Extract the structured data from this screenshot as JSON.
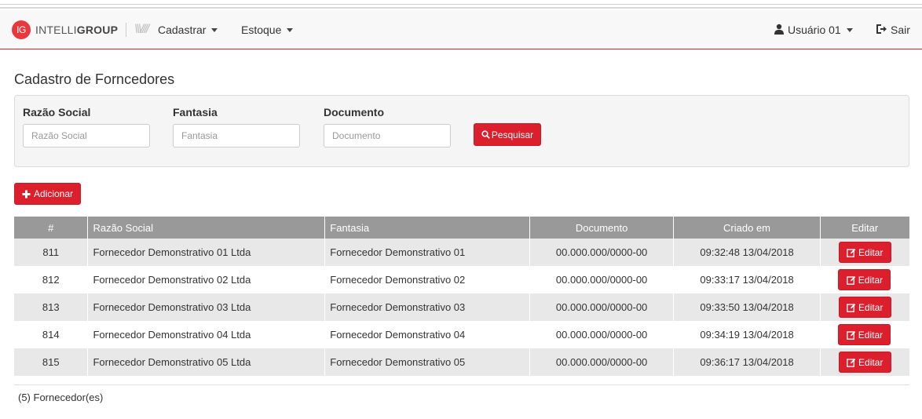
{
  "navbar": {
    "brand_badge": "IG",
    "brand_light": "INTELLI",
    "brand_bold": "GROUP",
    "brand_mark": "\\\\\\////",
    "menu": [
      {
        "label": "Cadastrar"
      },
      {
        "label": "Estoque"
      }
    ],
    "user_label": "Usuário 01",
    "logout_label": "Sair"
  },
  "page": {
    "title": "Cadastro de Forncedores"
  },
  "filters": {
    "razao_label": "Razão Social",
    "razao_placeholder": "Razão Social",
    "fantasia_label": "Fantasia",
    "fantasia_placeholder": "Fantasia",
    "documento_label": "Documento",
    "documento_placeholder": "Documento",
    "search_label": "Pesquisar"
  },
  "add_label": "Adicionar",
  "table": {
    "headers": {
      "id": "#",
      "razao": "Razão Social",
      "fantasia": "Fantasia",
      "documento": "Documento",
      "criado": "Criado em",
      "editar": "Editar"
    },
    "edit_label": "Editar",
    "rows": [
      {
        "id": "811",
        "razao": "Fornecedor Demonstrativo 01 Ltda",
        "fantasia": "Fornecedor Demonstrativo 01",
        "documento": "00.000.000/0000-00",
        "criado": "09:32:48 13/04/2018"
      },
      {
        "id": "812",
        "razao": "Fornecedor Demonstrativo 02 Ltda",
        "fantasia": "Fornecedor Demonstrativo 02",
        "documento": "00.000.000/0000-00",
        "criado": "09:33:17 13/04/2018"
      },
      {
        "id": "813",
        "razao": "Fornecedor Demonstrativo 03 Ltda",
        "fantasia": "Fornecedor Demonstrativo 03",
        "documento": "00.000.000/0000-00",
        "criado": "09:33:50 13/04/2018"
      },
      {
        "id": "814",
        "razao": "Fornecedor Demonstrativo 04 Ltda",
        "fantasia": "Fornecedor Demonstrativo 04",
        "documento": "00.000.000/0000-00",
        "criado": "09:34:19 13/04/2018"
      },
      {
        "id": "815",
        "razao": "Fornecedor Demonstrativo 05 Ltda",
        "fantasia": "Fornecedor Demonstrativo 05",
        "documento": "00.000.000/0000-00",
        "criado": "09:36:17 13/04/2018"
      }
    ]
  },
  "count_text": "(5) Fornecedor(es)",
  "colors": {
    "accent": "#dc1f2d",
    "header_bg": "#999999",
    "row_stripe": "#e8e8e8"
  },
  "icons": {
    "brand": "ig-logo-icon",
    "user": "user-icon",
    "logout": "logout-icon",
    "search": "search-icon",
    "add": "plus-icon",
    "edit": "edit-icon"
  }
}
